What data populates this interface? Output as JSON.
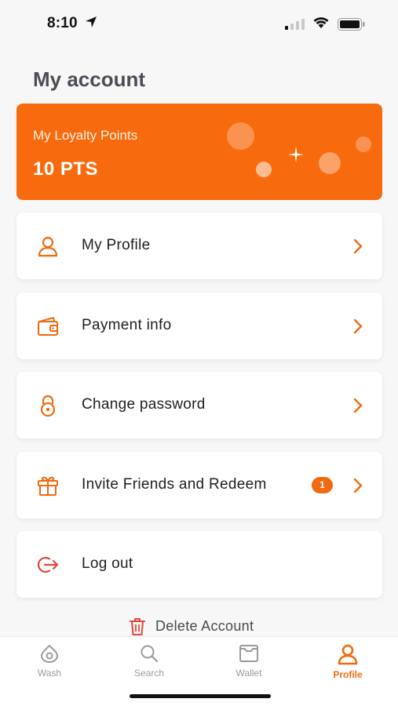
{
  "status_bar": {
    "time": "8:10"
  },
  "page": {
    "title": "My account"
  },
  "loyalty": {
    "label": "My Loyalty Points",
    "points": "10 PTS"
  },
  "menu": {
    "items": [
      {
        "label": "My Profile",
        "icon": "user-icon"
      },
      {
        "label": "Payment info",
        "icon": "wallet-icon"
      },
      {
        "label": "Change password",
        "icon": "lock-icon"
      },
      {
        "label": "Invite Friends and Redeem",
        "icon": "gift-icon",
        "badge": "1"
      },
      {
        "label": "Log out",
        "icon": "logout-icon"
      }
    ]
  },
  "delete": {
    "label": "Delete Account",
    "icon": "trash-icon"
  },
  "tabs": [
    {
      "label": "Wash",
      "icon": "drop-icon",
      "active": false
    },
    {
      "label": "Search",
      "icon": "search-icon",
      "active": false
    },
    {
      "label": "Wallet",
      "icon": "wallet-icon",
      "active": false
    },
    {
      "label": "Profile",
      "icon": "user-icon",
      "active": true
    }
  ],
  "colors": {
    "accent": "#f86a0e",
    "logout": "#e0483a",
    "inactive_tab": "#9a9a9a"
  }
}
